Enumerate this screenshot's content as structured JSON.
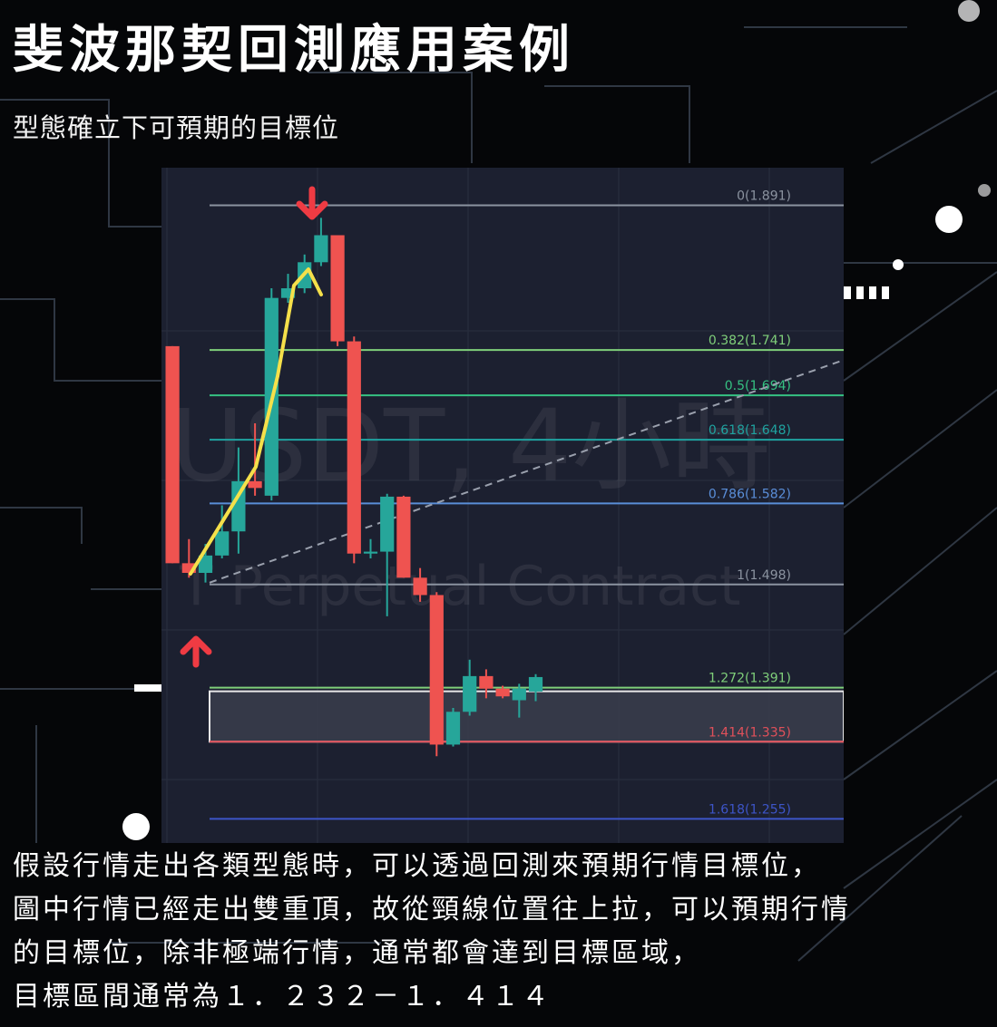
{
  "page": {
    "title": "斐波那契回測應用案例",
    "subtitle": "型態確立下可預期的目標位",
    "description_lines": [
      "假設行情走出各類型態時，可以透過回測來預期行情目標位，",
      "圖中行情已經走出雙重頂，故從頸線位置往上拉，可以預期行情",
      "的目標位，除非極端行情，通常都會達到目標區域，",
      "目標區間通常為１．２３２－１．４１４"
    ]
  },
  "chart_data": {
    "type": "candlestick",
    "watermark": [
      "USDT, 4小時",
      "T Perpetual Contract"
    ],
    "ylim": [
      1.23,
      1.93
    ],
    "candles": [
      {
        "o": 1.745,
        "h": 1.745,
        "l": 1.52,
        "c": 1.52
      },
      {
        "o": 1.52,
        "h": 1.545,
        "l": 1.505,
        "c": 1.51
      },
      {
        "o": 1.51,
        "h": 1.54,
        "l": 1.5,
        "c": 1.528
      },
      {
        "o": 1.528,
        "h": 1.58,
        "l": 1.525,
        "c": 1.553
      },
      {
        "o": 1.553,
        "h": 1.64,
        "l": 1.53,
        "c": 1.605
      },
      {
        "o": 1.605,
        "h": 1.665,
        "l": 1.59,
        "c": 1.598
      },
      {
        "o": 1.59,
        "h": 1.805,
        "l": 1.585,
        "c": 1.795
      },
      {
        "o": 1.795,
        "h": 1.82,
        "l": 1.79,
        "c": 1.805
      },
      {
        "o": 1.805,
        "h": 1.84,
        "l": 1.8,
        "c": 1.832
      },
      {
        "o": 1.832,
        "h": 1.878,
        "l": 1.828,
        "c": 1.86
      },
      {
        "o": 1.86,
        "h": 1.86,
        "l": 1.745,
        "c": 1.75
      },
      {
        "o": 1.75,
        "h": 1.755,
        "l": 1.52,
        "c": 1.53
      },
      {
        "o": 1.53,
        "h": 1.545,
        "l": 1.525,
        "c": 1.532
      },
      {
        "o": 1.532,
        "h": 1.592,
        "l": 1.465,
        "c": 1.589
      },
      {
        "o": 1.589,
        "h": 1.59,
        "l": 1.505,
        "c": 1.505
      },
      {
        "o": 1.505,
        "h": 1.515,
        "l": 1.48,
        "c": 1.487
      },
      {
        "o": 1.487,
        "h": 1.49,
        "l": 1.32,
        "c": 1.332
      },
      {
        "o": 1.332,
        "h": 1.37,
        "l": 1.33,
        "c": 1.366
      },
      {
        "o": 1.366,
        "h": 1.42,
        "l": 1.362,
        "c": 1.403
      },
      {
        "o": 1.403,
        "h": 1.41,
        "l": 1.38,
        "c": 1.39
      },
      {
        "o": 1.39,
        "h": 1.393,
        "l": 1.38,
        "c": 1.382
      },
      {
        "o": 1.378,
        "h": 1.395,
        "l": 1.36,
        "c": 1.39
      },
      {
        "o": 1.387,
        "h": 1.405,
        "l": 1.377,
        "c": 1.402
      }
    ],
    "fib_levels": [
      {
        "label": "0(1.891)",
        "ratio": 0,
        "price": 1.891,
        "color": "#8b93a0"
      },
      {
        "label": "0.382(1.741)",
        "ratio": 0.382,
        "price": 1.741,
        "color": "#7fcf7a"
      },
      {
        "label": "0.5(1.694)",
        "ratio": 0.5,
        "price": 1.694,
        "color": "#35c282"
      },
      {
        "label": "0.618(1.648)",
        "ratio": 0.618,
        "price": 1.648,
        "color": "#1fa3a0"
      },
      {
        "label": "0.786(1.582)",
        "ratio": 0.786,
        "price": 1.582,
        "color": "#5a8ed8"
      },
      {
        "label": "1(1.498)",
        "ratio": 1,
        "price": 1.498,
        "color": "#8b93a0"
      },
      {
        "label": "1.272(1.391)",
        "ratio": 1.272,
        "price": 1.391,
        "color": "#7fcf7a"
      },
      {
        "label": "1.414(1.335)",
        "ratio": 1.414,
        "price": 1.335,
        "color": "#e0505a"
      },
      {
        "label": "1.618(1.255)",
        "ratio": 1.618,
        "price": 1.255,
        "color": "#3d55c8"
      }
    ],
    "target_zone": {
      "from": 1.391,
      "to": 1.335
    },
    "colors": {
      "up": "#26a69a",
      "down": "#ef5350",
      "trend_arrow": "#f5e04a",
      "marker": "#ef3b43",
      "grid": "#2a2f3f",
      "panel": "#1c2030"
    }
  }
}
